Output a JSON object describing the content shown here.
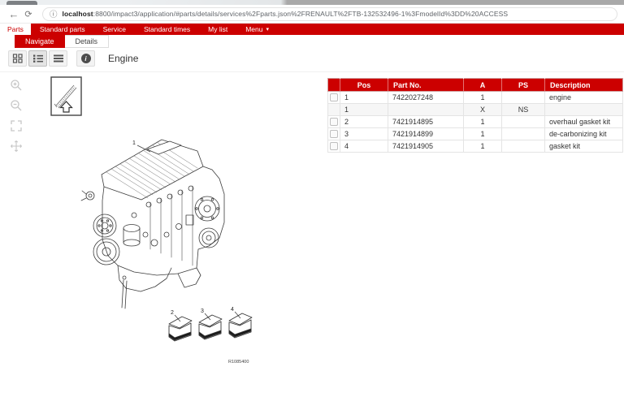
{
  "browser": {
    "url_host": "localhost",
    "url_rest": ":8800/impact3/application/#parts/details/services%2Fparts.json%2FRENAULT%2FTB-132532496-1%3FmodelId%3DD%20ACCESS"
  },
  "nav": {
    "items": [
      {
        "label": "Parts",
        "active": true
      },
      {
        "label": "Standard parts"
      },
      {
        "label": "Service"
      },
      {
        "label": "Standard times"
      },
      {
        "label": "My list"
      },
      {
        "label": "Menu",
        "caret": true
      }
    ]
  },
  "subtabs": {
    "navigate": "Navigate",
    "details": "Details"
  },
  "viewbar": {
    "title": "Engine"
  },
  "drawing": {
    "ref_code": "R1085400",
    "callout_engine": "1",
    "callout_box_1": "2",
    "callout_box_2": "3",
    "callout_box_3": "4"
  },
  "table": {
    "headers": {
      "pos": "Pos",
      "part_no": "Part No.",
      "a": "A",
      "ps": "PS",
      "description": "Description"
    },
    "rows": [
      {
        "checkbox": true,
        "pos": "1",
        "part_no": "7422027248",
        "a": "1",
        "ps": "",
        "description": "engine"
      },
      {
        "checkbox": false,
        "pos": "1",
        "part_no": "",
        "a": "X",
        "ps": "NS",
        "description": ""
      },
      {
        "checkbox": true,
        "pos": "2",
        "part_no": "7421914895",
        "a": "1",
        "ps": "",
        "description": "overhaul gasket kit"
      },
      {
        "checkbox": true,
        "pos": "3",
        "part_no": "7421914899",
        "a": "1",
        "ps": "",
        "description": "de-carbonizing kit"
      },
      {
        "checkbox": true,
        "pos": "4",
        "part_no": "7421914905",
        "a": "1",
        "ps": "",
        "description": "gasket kit"
      }
    ]
  },
  "colors": {
    "brand_red": "#cc0000"
  }
}
